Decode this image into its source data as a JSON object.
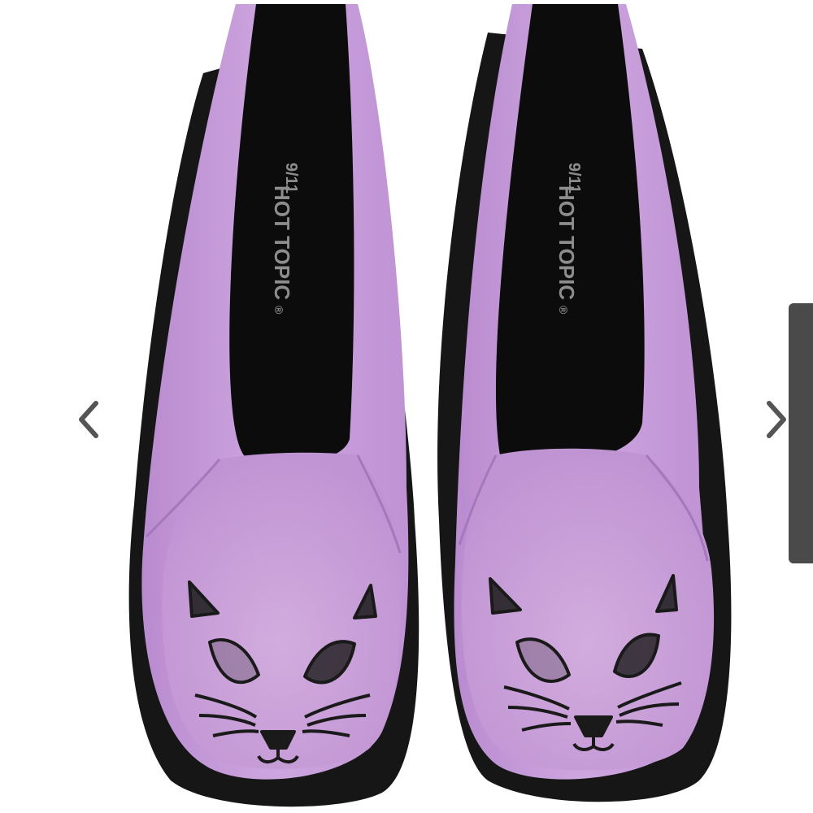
{
  "gallery": {
    "image_alt": "Lavender cat face slip-on shoes",
    "prev_icon": "chevron-left-icon",
    "next_icon": "chevron-right-icon",
    "insole": {
      "size": "9/11",
      "brand": "HOT TOPIC",
      "registered": "®"
    }
  },
  "colors": {
    "canvas": "#c9a1dc",
    "sole": "#161616",
    "background": "#ffffff",
    "chevron": "#555555",
    "scroll_tab": "#4a4a4a"
  }
}
